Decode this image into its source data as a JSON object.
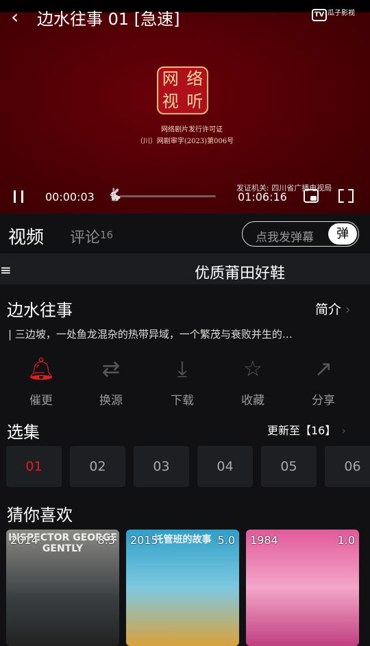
{
  "player": {
    "title": "边水往事 01 [急速]",
    "tv_label": "TV",
    "watermark": "瓜子影视",
    "seal_chars": [
      "网",
      "络",
      "视",
      "听"
    ],
    "license_title": "网络剧片发行许可证",
    "license_no": "（川）网剧审字(2023)第006号",
    "issuer": "发证机关: 四川省广播电视局",
    "current_time": "00:00:03",
    "duration": "01:06:16",
    "progress": 0.001
  },
  "tabs": {
    "video": "视频",
    "comments": "评论",
    "comment_count": "16",
    "danmaku_placeholder": "点我发弹幕",
    "danmaku_button": "弹"
  },
  "ad": {
    "text": "优质莆田好鞋"
  },
  "show": {
    "title": "边水往事",
    "intro_label": "简介",
    "description": "| 三边坡，一处鱼龙混杂的热带异域，一个繁茂与衰败并生的…"
  },
  "actions": [
    {
      "label": "催更",
      "icon": "bell-icon",
      "color": "#e02020"
    },
    {
      "label": "换源",
      "icon": "switch-source-icon",
      "color": "#555"
    },
    {
      "label": "下载",
      "icon": "download-icon",
      "color": "#555"
    },
    {
      "label": "收藏",
      "icon": "star-icon",
      "color": "#555"
    },
    {
      "label": "分享",
      "icon": "share-icon",
      "color": "#555"
    }
  ],
  "episodes": {
    "title": "选集",
    "update": "更新至【16】",
    "items": [
      "01",
      "02",
      "03",
      "04",
      "05",
      "06"
    ],
    "selected": "01"
  },
  "recommend": {
    "title": "猜你喜欢",
    "items": [
      {
        "year": "2014",
        "score": "8.3",
        "poster_text": "INSPECTOR GEORGE GENTLY"
      },
      {
        "year": "2015",
        "score": "5.0",
        "poster_text": "托管班的故事"
      },
      {
        "year": "1984",
        "score": "1.0",
        "poster_text": ""
      }
    ]
  }
}
